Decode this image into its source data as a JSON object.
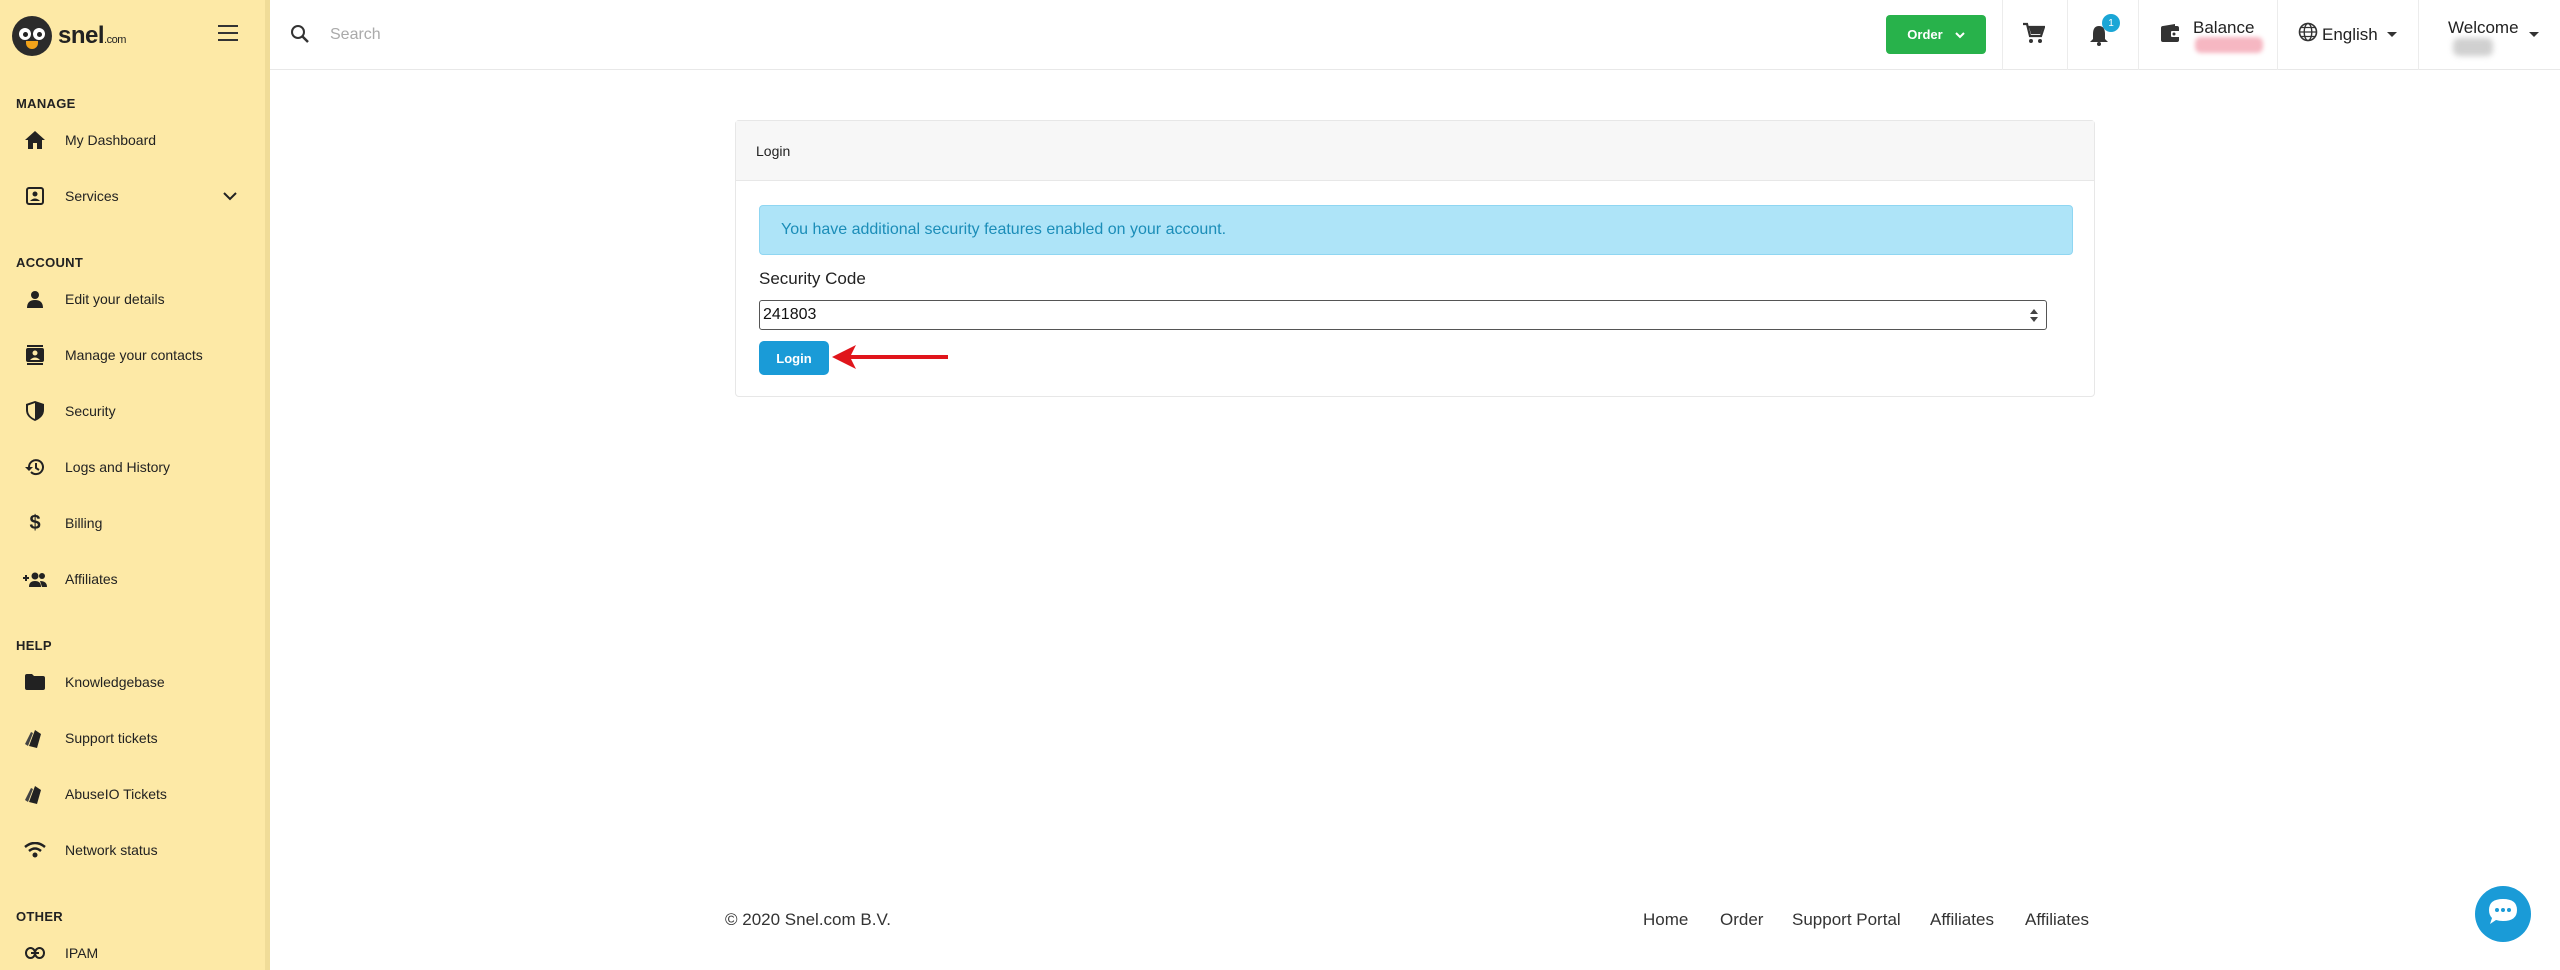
{
  "brand": {
    "name": "snel",
    "suffix": ".com"
  },
  "search": {
    "placeholder": "Search"
  },
  "topbar": {
    "order_label": "Order",
    "notification_count": "1",
    "balance_label": "Balance",
    "language": "English",
    "welcome_label": "Welcome"
  },
  "sidebar": {
    "sections": {
      "manage": "MANAGE",
      "account": "ACCOUNT",
      "help": "HELP",
      "other": "OTHER"
    },
    "items": [
      {
        "label": "My Dashboard",
        "icon": "home-icon"
      },
      {
        "label": "Services",
        "icon": "services-icon"
      },
      {
        "label": "Edit your details",
        "icon": "person-icon"
      },
      {
        "label": "Manage your contacts",
        "icon": "contacts-icon"
      },
      {
        "label": "Security",
        "icon": "shield-icon"
      },
      {
        "label": "Logs and History",
        "icon": "history-icon"
      },
      {
        "label": "Billing",
        "icon": "dollar-icon"
      },
      {
        "label": "Affiliates",
        "icon": "group-add-icon"
      },
      {
        "label": "Knowledgebase",
        "icon": "folder-icon"
      },
      {
        "label": "Support tickets",
        "icon": "ticket-icon"
      },
      {
        "label": "AbuseIO Tickets",
        "icon": "ticket-icon"
      },
      {
        "label": "Network status",
        "icon": "wifi-icon"
      },
      {
        "label": "IPAM",
        "icon": "link-icon"
      }
    ]
  },
  "login_card": {
    "title": "Login",
    "alert": "You have additional security features enabled on your account.",
    "field_label": "Security Code",
    "code_value": "241803",
    "button_label": "Login"
  },
  "footer": {
    "copyright": "© 2020 Snel.com B.V.",
    "links": [
      "Home",
      "Order",
      "Support Portal",
      "Affiliates",
      "Affiliates"
    ]
  },
  "colors": {
    "sidebar_bg": "#fde9a6",
    "order_green": "#28b24b",
    "primary_blue": "#1a9bd7",
    "alert_bg": "#aee4f8",
    "annotation_red": "#e0151b"
  }
}
